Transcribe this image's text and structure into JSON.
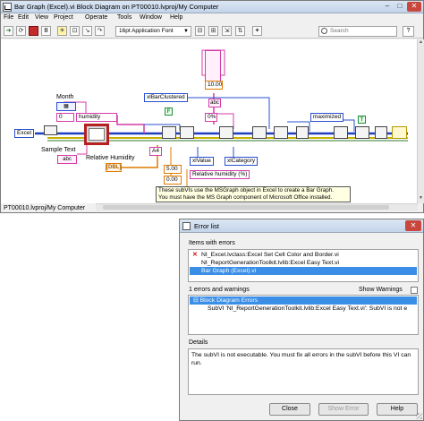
{
  "block_diagram": {
    "title": "Bar Graph (Excel).vi Block Diagram on PT00010.lvproj/My Computer",
    "menu": [
      "File",
      "Edit",
      "View",
      "Project",
      "Operate",
      "Tools",
      "Window",
      "Help"
    ],
    "toolbar": {
      "font": "16pt Application Font",
      "search_placeholder": "Search",
      "help": "?"
    },
    "labels": {
      "month": "Month",
      "sample_text": "Sample Text",
      "relative_humidity": "Relative Humidity"
    },
    "constants": {
      "excel": "Excel",
      "humidity": "humidity",
      "zero": "0",
      "ten": "10.00",
      "percent": "0%",
      "five": "5.00",
      "zero_float": "0.00",
      "xl_bar": "xlBarClustered",
      "xl_value": "xlValue",
      "xl_category": "xlCategory",
      "rh_percent": "Relative humidity (%)",
      "maximized": "maximized",
      "f": "F",
      "a4": "A4"
    },
    "tooltip": [
      "These subVIs use the MSGraph object in Excel to create a Bar Graph.",
      "You must have the MS Graph component of Microsoft Office installed."
    ],
    "status": "PT00010.lvproj/My Computer"
  },
  "error_list": {
    "title": "Error list",
    "items_label": "Items with errors",
    "items": [
      "NI_Excel.lvclass:Excel Set Cell Color and Border.vi",
      "NI_ReportGenerationToolkit.lvlib:Excel Easy Text.vi",
      "Bar Graph (Excel).vi"
    ],
    "errors_label": "1 errors and warnings",
    "show_warnings": "Show Warnings",
    "errors": [
      "Block Diagram Errors",
      "SubVI 'NI_ReportGenerationToolkit.lvlib:Excel Easy Text.vi': SubVI is not e"
    ],
    "details_label": "Details",
    "details": "The subVI is not executable. You must fix all errors in the subVI before this VI can run.",
    "buttons": {
      "close": "Close",
      "show_error": "Show Error",
      "help": "Help"
    }
  }
}
